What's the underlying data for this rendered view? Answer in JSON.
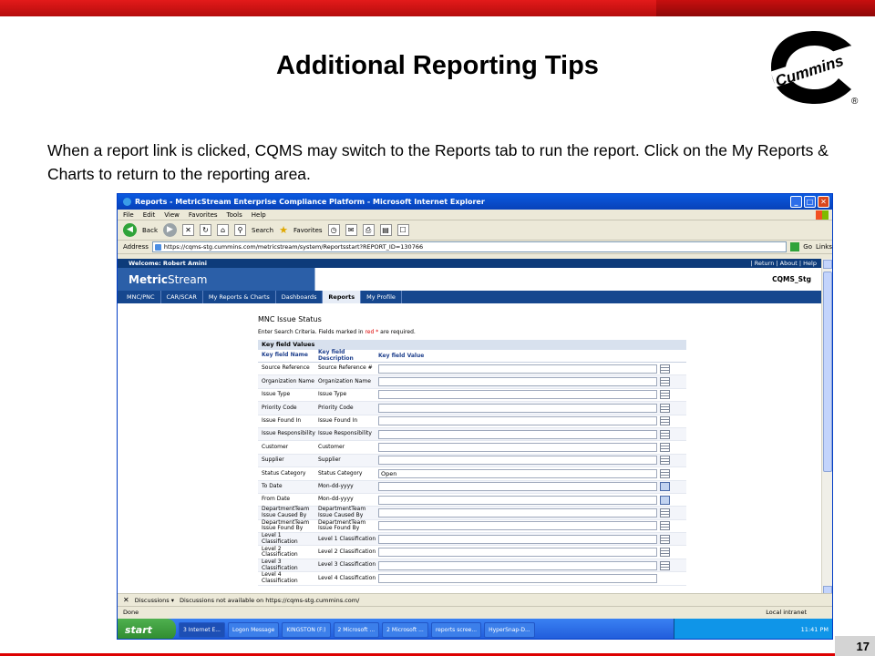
{
  "slide": {
    "title": "Additional Reporting Tips",
    "body": "When a report link is clicked, CQMS may switch to the Reports tab to run the report.  Click on the My Reports & Charts to return to the reporting area.",
    "page_number": "17",
    "logo_text": "Cummins",
    "registered": "®",
    "colors": {
      "accent": "#d00000",
      "logo": "#000000"
    }
  },
  "browser": {
    "window_title": "Reports - MetricStream Enterprise Compliance Platform - Microsoft Internet Explorer",
    "menu": [
      "File",
      "Edit",
      "View",
      "Favorites",
      "Tools",
      "Help"
    ],
    "toolbar": {
      "back": "Back",
      "search": "Search",
      "favorites": "Favorites"
    },
    "address_label": "Address",
    "address_url": "https://cqms-stg.cummins.com/metricstream/system/Reportsstart?REPORT_ID=130766",
    "go": "Go",
    "links": "Links",
    "page": {
      "welcome": "Welcome: Robert Amini",
      "top_links": "| Return | About | Help",
      "brand_metric": "Metric",
      "brand_stream": "Stream",
      "env": "CQMS_Stg",
      "tabs": [
        "MNC/PNC",
        "CAR/SCAR",
        "My Reports & Charts",
        "Dashboards",
        "Reports",
        "My Profile"
      ],
      "active_tab": "Reports",
      "form": {
        "title": "MNC Issue Status",
        "hint_pre": "Enter Search Criteria. Fields marked in",
        "hint_red": "red *",
        "hint_post": "are required.",
        "section": "Key field Values",
        "columns": [
          "Key field Name",
          "Key field Description",
          "Key field Value"
        ],
        "rows": [
          {
            "name": "Source Reference",
            "desc": "Source Reference #",
            "value": "",
            "picker": "list"
          },
          {
            "name": "Organization Name",
            "desc": "Organization Name",
            "value": "",
            "picker": "list"
          },
          {
            "name": "Issue Type",
            "desc": "Issue Type",
            "value": "",
            "picker": "list"
          },
          {
            "name": "Priority Code",
            "desc": "Priority Code",
            "value": "",
            "picker": "list"
          },
          {
            "name": "Issue Found In",
            "desc": "Issue Found In",
            "value": "",
            "picker": "list"
          },
          {
            "name": "Issue Responsibility",
            "desc": "Issue Responsibility",
            "value": "",
            "picker": "list"
          },
          {
            "name": "Customer",
            "desc": "Customer",
            "value": "",
            "picker": "list"
          },
          {
            "name": "Supplier",
            "desc": "Supplier",
            "value": "",
            "picker": "list"
          },
          {
            "name": "Status Category",
            "desc": "Status Category",
            "value": "Open",
            "picker": "list"
          },
          {
            "name": "To Date",
            "desc": "Mon-dd-yyyy",
            "value": "",
            "picker": "calendar"
          },
          {
            "name": "From Date",
            "desc": "Mon-dd-yyyy",
            "value": "",
            "picker": "calendar"
          },
          {
            "name": "DepartmentTeam Issue Caused By",
            "desc": "DepartmentTeam Issue Caused By",
            "value": "",
            "picker": "list"
          },
          {
            "name": "DepartmentTeam Issue Found By",
            "desc": "DepartmentTeam Issue Found By",
            "value": "",
            "picker": "list"
          },
          {
            "name": "Level 1 Classification",
            "desc": "Level 1 Classification",
            "value": "",
            "picker": "list"
          },
          {
            "name": "Level 2 Classification",
            "desc": "Level 2 Classification",
            "value": "",
            "picker": "list"
          },
          {
            "name": "Level 3 Classification",
            "desc": "Level 3 Classification",
            "value": "",
            "picker": "list"
          },
          {
            "name": "Level 4 Classification",
            "desc": "Level 4 Classification",
            "value": "",
            "picker": "none"
          }
        ]
      }
    },
    "discussions": "Discussions ▾",
    "discussions_msg": "Discussions not available on https://cqms-stg.cummins.com/",
    "status": "Done",
    "zone": "Local intranet",
    "start": "start",
    "tasks": [
      "3 Internet E...",
      "Logon Message",
      "KINGSTON (F:)",
      "2 Microsoft ...",
      "2 Microsoft ...",
      "reports scree...",
      "HyperSnap-D..."
    ],
    "clock": "11:41 PM"
  }
}
